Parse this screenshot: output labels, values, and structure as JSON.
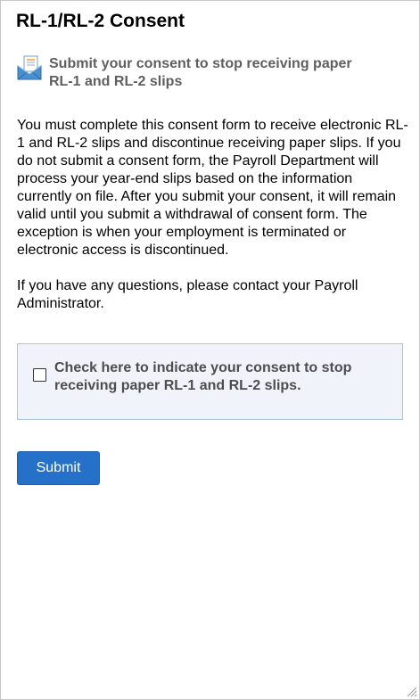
{
  "page": {
    "title": "RL-1/RL-2 Consent",
    "subtitle": "Submit your consent to stop receiving paper RL-1 and RL-2 slips",
    "subtitle_icon": "mail-icon"
  },
  "body": {
    "paragraph1": "You must complete this consent form to receive electronic RL-1 and RL-2 slips and discontinue receiving paper slips. If you do not submit a consent form, the Payroll Department will process your year-end slips based on the information currently on file.  After you submit your consent, it will remain valid until you submit a withdrawal of consent form.  The exception is when your employment is terminated or electronic access is discontinued.",
    "paragraph2": "If you have any questions, please contact your Payroll Administrator."
  },
  "consent": {
    "checked": false,
    "label": "Check here to indicate your consent to stop receiving paper RL-1 and RL-2 slips."
  },
  "actions": {
    "submit_label": "Submit"
  },
  "colors": {
    "accent": "#2571c9",
    "consent_box_bg": "#f0f4fa",
    "consent_box_border": "#a9c3dc",
    "subtitle_text": "#5f5f5f"
  }
}
